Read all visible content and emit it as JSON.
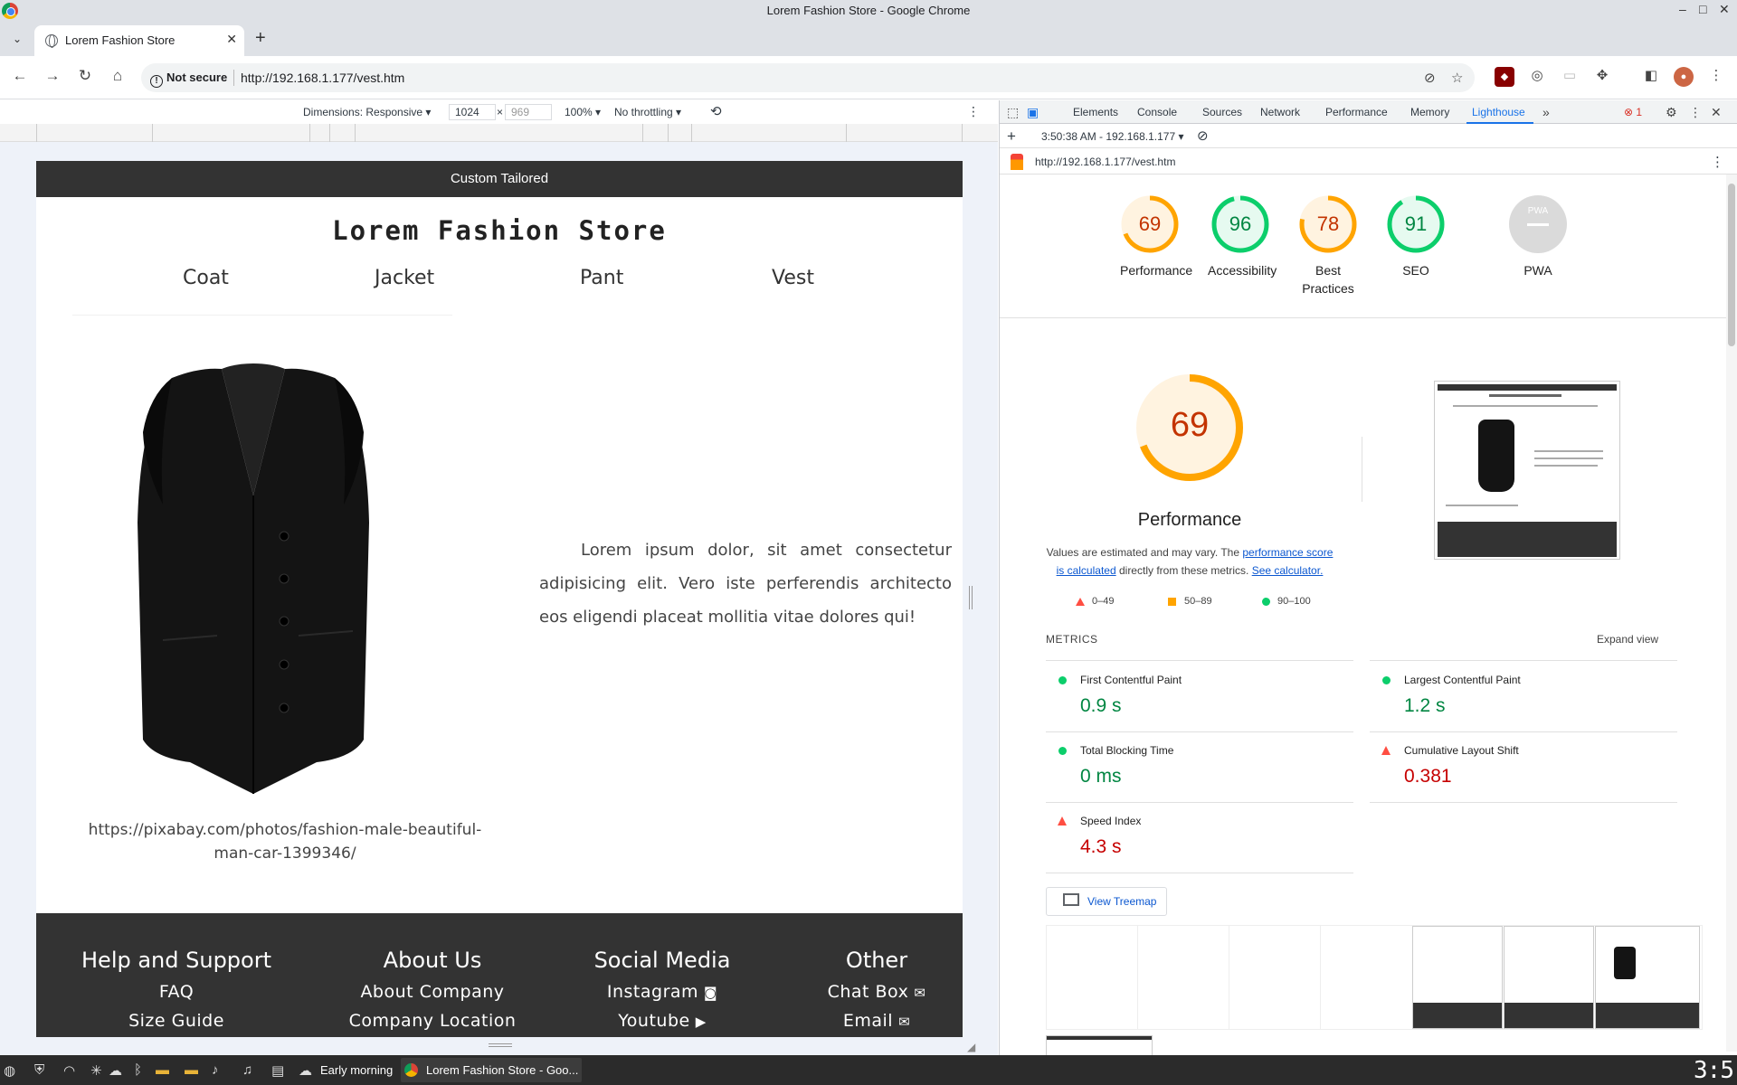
{
  "window": {
    "title": "Lorem Fashion Store - Google Chrome",
    "controls": {
      "minimize": "–",
      "maximize": "□",
      "close": "✕"
    }
  },
  "tabs": {
    "active_title": "Lorem Fashion Store",
    "new_tab": "+",
    "list_button": "⌄",
    "close": "✕"
  },
  "toolbar": {
    "back": "←",
    "forward": "→",
    "reload": "↻",
    "home": "⌂",
    "security_label": "Not secure",
    "url": "http://192.168.1.177/vest.htm"
  },
  "device_toolbar": {
    "dimensions_label": "Dimensions: Responsive",
    "width": "1024",
    "times": "×",
    "height": "969",
    "zoom": "100%",
    "throttling": "No throttling"
  },
  "site": {
    "promo": "Custom Tailored",
    "title": "Lorem Fashion Store",
    "nav": [
      "Coat",
      "Jacket",
      "Pant",
      "Vest"
    ],
    "description": "Lorem ipsum dolor, sit amet consectetur adipisicing elit. Vero iste perferendis architecto eos eligendi placeat mollitia vitae dolores qui!",
    "credit": "https://pixabay.com/photos/fashion-male-beautiful-man-car-1399346/",
    "footer": {
      "help": {
        "heading": "Help and Support",
        "links": [
          "FAQ",
          "Size  Guide"
        ]
      },
      "about": {
        "heading": "About Us",
        "links": [
          "About  Company",
          "Company  Location"
        ]
      },
      "social": {
        "heading": "Social Media",
        "links": [
          "Instagram",
          "Youtube"
        ]
      },
      "other": {
        "heading": "Other",
        "links": [
          "Chat  Box",
          "Email"
        ]
      }
    }
  },
  "devtools": {
    "tabs": [
      "Elements",
      "Console",
      "Sources",
      "Network",
      "Performance",
      "Memory",
      "Lighthouse"
    ],
    "active_tab": "Lighthouse",
    "error_count": "1",
    "report_selector": "3:50:38 AM - 192.168.1.177",
    "report_url": "http://192.168.1.177/vest.htm"
  },
  "lighthouse": {
    "scores": [
      {
        "label": "Performance",
        "value": 69,
        "color": "#ffa400"
      },
      {
        "label": "Accessibility",
        "value": 96,
        "color": "#0cce6b"
      },
      {
        "label": "Best Practices",
        "value": 78,
        "color": "#ffa400"
      },
      {
        "label": "SEO",
        "value": 91,
        "color": "#0cce6b"
      },
      {
        "label": "PWA",
        "value": "PWA",
        "color": "#cccccc"
      }
    ],
    "big_score": 69,
    "big_label": "Performance",
    "note_prefix": "Values are estimated and may vary. The ",
    "note_link1": "performance score is calculated",
    "note_middle": " directly from these metrics. ",
    "note_link2": "See calculator.",
    "legend": {
      "fail": "0–49",
      "average": "50–89",
      "pass": "90–100"
    },
    "metrics_heading": "METRICS",
    "expand": "Expand view",
    "metrics": [
      {
        "name": "First Contentful Paint",
        "value": "0.9 s",
        "status": "pass"
      },
      {
        "name": "Largest Contentful Paint",
        "value": "1.2 s",
        "status": "pass"
      },
      {
        "name": "Total Blocking Time",
        "value": "0 ms",
        "status": "pass"
      },
      {
        "name": "Cumulative Layout Shift",
        "value": "0.381",
        "status": "fail"
      },
      {
        "name": "Speed Index",
        "value": "4.3 s",
        "status": "fail"
      }
    ],
    "treemap": "View Treemap"
  },
  "taskbar": {
    "weather": "Early morning",
    "task_label": "Lorem Fashion Store - Goo...",
    "clock": "3:5"
  }
}
